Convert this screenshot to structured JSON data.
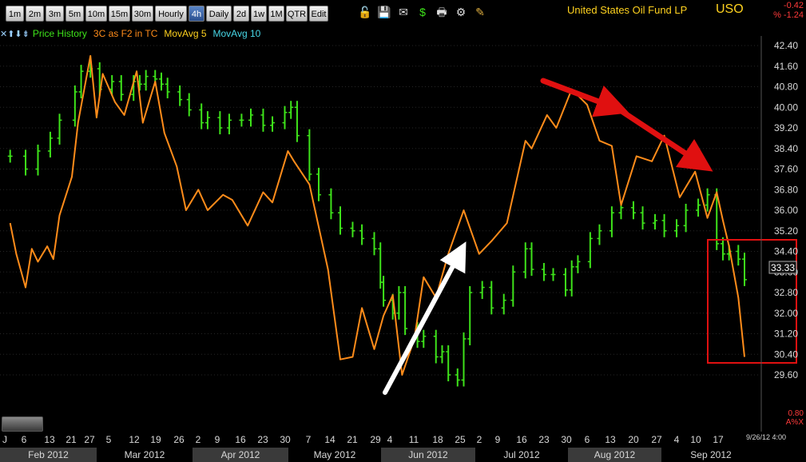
{
  "toolbar": {
    "buttons": [
      "1m",
      "2m",
      "3m",
      "5m",
      "10m",
      "15m",
      "30m",
      "Hourly",
      "4h",
      "Daily",
      "2d",
      "1w",
      "1M",
      "QTR",
      "Edit"
    ],
    "active": "4h",
    "icons": [
      "unlock-icon",
      "save-icon",
      "mail-icon",
      "dollar-icon",
      "print-icon",
      "settings-icon",
      "pencil-icon"
    ]
  },
  "header": {
    "name": "United States Oil Fund LP",
    "symbol": "USO",
    "change": "-0.42",
    "change_pct": "% -1.24"
  },
  "legend": {
    "nav": "✕⬆⬇⇟",
    "price": "Price History",
    "indicator": "3C as F2 in TC",
    "ma5": "MovAvg 5",
    "ma10": "MovAvg 10"
  },
  "footer": {
    "timestamp": "9/26/12 4:00",
    "scale_value": "0.80",
    "ax_label": "A%X",
    "j_label": "J"
  },
  "colors": {
    "price": "#3ee31a",
    "indicator": "#ff8c1a",
    "ma5": "#ffd21f",
    "ma10": "#48d8e8",
    "arrow_red": "#e01010",
    "arrow_white": "#ffffff",
    "box": "#e01010"
  },
  "chart_data": {
    "type": "line",
    "title": "United States Oil Fund LP",
    "ylim": [
      29.2,
      42.7
    ],
    "y_ticks": [
      "42.40",
      "41.60",
      "40.80",
      "40.00",
      "39.20",
      "38.40",
      "37.60",
      "36.80",
      "36.00",
      "35.20",
      "34.40",
      "33.60",
      "32.80",
      "32.00",
      "31.20",
      "30.40",
      "29.60"
    ],
    "last_price": "33.33",
    "x_day_ticks": [
      "6",
      "13",
      "21",
      "27",
      "5",
      "12",
      "19",
      "26",
      "2",
      "9",
      "16",
      "23",
      "30",
      "7",
      "14",
      "21",
      "29",
      "4",
      "11",
      "18",
      "25",
      "2",
      "9",
      "16",
      "23",
      "30",
      "6",
      "13",
      "20",
      "27",
      "4",
      "10",
      "17"
    ],
    "x_months": [
      "Feb 2012",
      "Mar 2012",
      "Apr 2012",
      "May 2012",
      "Jun 2012",
      "Jul 2012",
      "Aug 2012",
      "Sep 2012"
    ],
    "series": [
      {
        "name": "Price History",
        "type": "ohlc",
        "x": [
          "2012-02-01",
          "2012-02-06",
          "2012-02-10",
          "2012-02-14",
          "2012-02-17",
          "2012-02-22",
          "2012-02-24",
          "2012-02-27",
          "2012-03-01",
          "2012-03-05",
          "2012-03-08",
          "2012-03-12",
          "2012-03-14",
          "2012-03-16",
          "2012-03-19",
          "2012-03-21",
          "2012-03-23",
          "2012-03-27",
          "2012-03-30",
          "2012-04-03",
          "2012-04-05",
          "2012-04-09",
          "2012-04-12",
          "2012-04-16",
          "2012-04-19",
          "2012-04-23",
          "2012-04-26",
          "2012-04-30",
          "2012-05-02",
          "2012-05-04",
          "2012-05-08",
          "2012-05-11",
          "2012-05-15",
          "2012-05-18",
          "2012-05-22",
          "2012-05-25",
          "2012-05-29",
          "2012-05-31",
          "2012-06-01",
          "2012-06-04",
          "2012-06-06",
          "2012-06-08",
          "2012-06-12",
          "2012-06-14",
          "2012-06-18",
          "2012-06-20",
          "2012-06-22",
          "2012-06-25",
          "2012-06-27",
          "2012-06-29",
          "2012-07-03",
          "2012-07-06",
          "2012-07-10",
          "2012-07-13",
          "2012-07-17",
          "2012-07-19",
          "2012-07-23",
          "2012-07-26",
          "2012-07-30",
          "2012-08-01",
          "2012-08-03",
          "2012-08-07",
          "2012-08-10",
          "2012-08-14",
          "2012-08-17",
          "2012-08-21",
          "2012-08-24",
          "2012-08-28",
          "2012-08-31",
          "2012-09-04",
          "2012-09-07",
          "2012-09-11",
          "2012-09-14",
          "2012-09-17",
          "2012-09-19",
          "2012-09-21",
          "2012-09-24",
          "2012-09-26"
        ],
        "values": [
          38.1,
          37.6,
          38.3,
          38.8,
          39.5,
          40.6,
          41.4,
          41.5,
          40.7,
          41.0,
          40.5,
          41.0,
          40.9,
          41.2,
          41.1,
          40.9,
          40.6,
          40.3,
          39.9,
          39.4,
          39.6,
          39.2,
          39.5,
          39.5,
          39.7,
          39.3,
          39.4,
          39.8,
          40.0,
          38.9,
          37.4,
          36.6,
          35.9,
          35.3,
          35.2,
          34.9,
          34.5,
          33.2,
          32.5,
          32.0,
          32.8,
          31.4,
          30.9,
          31.1,
          30.3,
          30.5,
          29.6,
          29.4,
          31.0,
          32.8,
          33.0,
          32.2,
          32.5,
          33.6,
          34.5,
          33.7,
          33.5,
          33.5,
          32.9,
          33.8,
          34.0,
          34.9,
          35.2,
          35.9,
          36.1,
          35.9,
          35.5,
          35.6,
          35.2,
          35.4,
          36.0,
          36.2,
          36.6,
          34.7,
          34.3,
          34.4,
          34.1,
          33.3
        ]
      },
      {
        "name": "3C as F2 in TC",
        "x": [
          "2012-02-01",
          "2012-02-03",
          "2012-02-06",
          "2012-02-08",
          "2012-02-10",
          "2012-02-13",
          "2012-02-15",
          "2012-02-17",
          "2012-02-21",
          "2012-02-23",
          "2012-02-27",
          "2012-02-29",
          "2012-03-02",
          "2012-03-06",
          "2012-03-09",
          "2012-03-13",
          "2012-03-15",
          "2012-03-19",
          "2012-03-22",
          "2012-03-26",
          "2012-03-29",
          "2012-04-02",
          "2012-04-05",
          "2012-04-10",
          "2012-04-13",
          "2012-04-18",
          "2012-04-23",
          "2012-04-26",
          "2012-05-01",
          "2012-05-03",
          "2012-05-08",
          "2012-05-14",
          "2012-05-18",
          "2012-05-22",
          "2012-05-25",
          "2012-05-29",
          "2012-06-01",
          "2012-06-04",
          "2012-06-07",
          "2012-06-11",
          "2012-06-14",
          "2012-06-18",
          "2012-06-22",
          "2012-06-27",
          "2012-07-02",
          "2012-07-06",
          "2012-07-11",
          "2012-07-17",
          "2012-07-19",
          "2012-07-24",
          "2012-07-27",
          "2012-08-01",
          "2012-08-06",
          "2012-08-10",
          "2012-08-14",
          "2012-08-17",
          "2012-08-22",
          "2012-08-27",
          "2012-08-31",
          "2012-09-05",
          "2012-09-10",
          "2012-09-14",
          "2012-09-17",
          "2012-09-19",
          "2012-09-21",
          "2012-09-24",
          "2012-09-26"
        ],
        "values": [
          35.5,
          34.3,
          33.0,
          34.5,
          34.0,
          34.6,
          34.1,
          35.8,
          37.3,
          39.4,
          42.0,
          39.6,
          41.3,
          40.2,
          39.7,
          41.4,
          39.4,
          41.0,
          39.0,
          37.7,
          36.0,
          36.8,
          36.0,
          36.6,
          36.4,
          35.4,
          36.7,
          36.3,
          38.3,
          37.9,
          37.0,
          33.7,
          30.2,
          30.3,
          32.2,
          30.6,
          31.9,
          32.7,
          29.6,
          31.0,
          33.4,
          32.6,
          34.3,
          36.0,
          34.3,
          34.8,
          35.5,
          38.7,
          38.4,
          39.7,
          39.2,
          40.7,
          40.1,
          38.7,
          38.5,
          36.2,
          38.1,
          37.9,
          38.9,
          36.5,
          37.5,
          35.7,
          36.7,
          35.6,
          34.6,
          32.6,
          30.3
        ]
      }
    ]
  }
}
